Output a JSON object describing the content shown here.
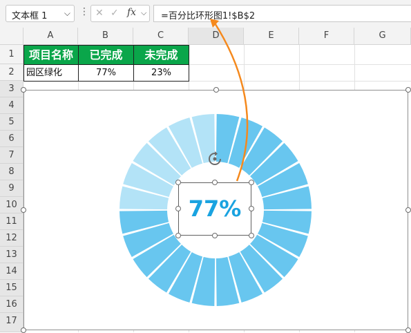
{
  "formula_bar": {
    "name_box": "文本框 1",
    "name_box_dropdown": "⌵",
    "more": "⋮",
    "cancel": "✕",
    "enter": "✓",
    "fx": "fx",
    "fx_dropdown": "⌵",
    "formula": "=百分比环形图1!$B$2"
  },
  "columns": [
    "A",
    "B",
    "C",
    "D",
    "E",
    "F",
    "G"
  ],
  "rows": [
    "1",
    "2",
    "3",
    "4",
    "5",
    "6",
    "7",
    "8",
    "9",
    "10",
    "11",
    "12",
    "13",
    "14",
    "15",
    "16",
    "17"
  ],
  "table": {
    "headers": [
      "项目名称",
      "已完成",
      "未完成"
    ],
    "row": [
      "园区绿化",
      "77%",
      "23%"
    ]
  },
  "chart": {
    "label": "77%",
    "completed_fraction": 0.77,
    "completed_color": "#68c6ef",
    "remaining_color": "#b3e3f7",
    "segments": 24
  },
  "chart_data": {
    "type": "pie",
    "categories": [
      "已完成",
      "未完成"
    ],
    "values": [
      0.77,
      0.23
    ]
  },
  "arrow_color": "#f5891d"
}
